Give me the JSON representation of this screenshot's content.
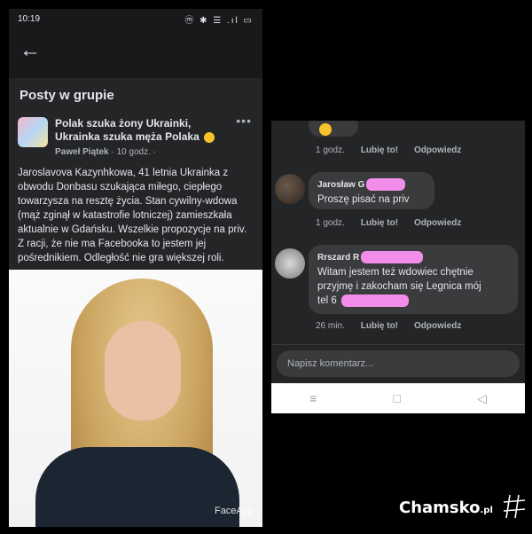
{
  "left": {
    "status_time": "10:19",
    "status_icons": "ⓜ ✱ ☰ .ıl ▭",
    "section_title": "Posty w grupie",
    "group_name_line1": "Polak szuka  żony Ukrainki,",
    "group_name_line2": "Ukrainka szuka męża Polaka",
    "author": "Paweł Piątek",
    "time": "· 10 godz. ·",
    "post_text": "Jaroslavova Kazynhkowa, 41 letnia Ukrainka z obwodu Donbasu szukająca miłego, ciepłego towarzysza na resztę życia. Stan cywilny-wdowa (mąż zginął w katastrofie lotniczej) zamieszkała aktualnie w Gdańsku. Wszelkie propozycje na priv. Z racji, że nie ma Facebooka to jestem jej pośrednikiem. Odległość nie gra większej roli.",
    "photo_watermark": "FaceApp",
    "icons": [
      "back-arrow-icon",
      "more-dots-icon",
      "smile-emoji-icon"
    ]
  },
  "right": {
    "comment0": {
      "time": "1 godz.",
      "like": "Lubię to!",
      "reply": "Odpowiedz"
    },
    "comment1": {
      "name": "Jarosław G",
      "text": "Proszę pisać  na priv",
      "time": "1 godz.",
      "like": "Lubię to!",
      "reply": "Odpowiedz"
    },
    "comment2": {
      "name": "Rrszard R",
      "text_line1": "Witam jestem też wdowiec chętnie",
      "text_line2": "przyjmę i zakocham się Legnica mój",
      "text_line3": "tel 6",
      "time": "26 min.",
      "like": "Lubię to!",
      "reply": "Odpowiedz"
    },
    "input_placeholder": "Napisz komentarz...",
    "nav_icons": [
      "≡",
      "□",
      "◁"
    ]
  },
  "watermark": {
    "site": "Chamsko",
    "tld": ".pl"
  },
  "colors": {
    "dark_bg": "#242526",
    "bubble": "#3a3b3c",
    "text": "#e4e6eb",
    "redact": "#f28dea"
  }
}
